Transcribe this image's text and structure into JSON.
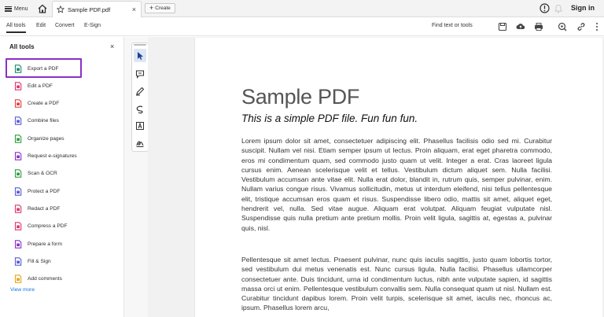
{
  "titlebar": {
    "menu_label": "Menu",
    "tab_label": "Sample PDF.pdf",
    "tab_close": "×",
    "create_label": "Create",
    "signin_label": "Sign in"
  },
  "menubar": {
    "tabs": [
      "All tools",
      "Edit",
      "Convert",
      "E-Sign"
    ],
    "find_label": "Find text or tools"
  },
  "left_panel": {
    "title": "All tools",
    "close": "×",
    "items": [
      {
        "label": "Export a PDF",
        "icon": "export-pdf-icon",
        "color": "#1a8a6c"
      },
      {
        "label": "Edit a PDF",
        "icon": "edit-pdf-icon",
        "color": "#e0356b"
      },
      {
        "label": "Create a PDF",
        "icon": "create-pdf-icon",
        "color": "#e0413a"
      },
      {
        "label": "Combine files",
        "icon": "combine-files-icon",
        "color": "#5a5ad8"
      },
      {
        "label": "Organize pages",
        "icon": "organize-pages-icon",
        "color": "#2f9d3f"
      },
      {
        "label": "Request e-signatures",
        "icon": "request-esignatures-icon",
        "color": "#8b2fc9"
      },
      {
        "label": "Scan & OCR",
        "icon": "scan-ocr-icon",
        "color": "#2f9d3f"
      },
      {
        "label": "Protect a PDF",
        "icon": "protect-pdf-icon",
        "color": "#5a5ad8"
      },
      {
        "label": "Redact a PDF",
        "icon": "redact-pdf-icon",
        "color": "#e0356b"
      },
      {
        "label": "Compress a PDF",
        "icon": "compress-pdf-icon",
        "color": "#e0356b"
      },
      {
        "label": "Prepare a form",
        "icon": "prepare-form-icon",
        "color": "#8b2fc9"
      },
      {
        "label": "Fill & Sign",
        "icon": "fill-sign-icon",
        "color": "#5a5ad8"
      },
      {
        "label": "Add comments",
        "icon": "add-comments-icon",
        "color": "#e8a317"
      }
    ],
    "view_more": "View more"
  },
  "document": {
    "title": "Sample PDF",
    "subtitle": "This is a simple PDF file. Fun fun fun.",
    "paragraph1": "Lorem ipsum dolor sit amet, consectetuer adipiscing elit. Phasellus facilisis odio sed mi. Curabitur suscipit. Nullam vel nisi. Etiam semper ipsum ut lectus. Proin aliquam, erat eget pharetra commodo, eros mi condimentum quam, sed commodo justo quam ut velit. Integer a erat. Cras laoreet ligula cursus enim. Aenean scelerisque velit et tellus. Vestibulum dictum aliquet sem. Nulla facilisi. Vestibulum accumsan ante vitae elit. Nulla erat dolor, blandit in, rutrum quis, semper pulvinar, enim. Nullam varius congue risus. Vivamus sollicitudin, metus ut interdum eleifend, nisi tellus pellentesque elit, tristique accumsan eros quam et risus. Suspendisse libero odio, mattis sit amet, aliquet eget, hendrerit vel, nulla. Sed vitae augue. Aliquam erat volutpat. Aliquam feugiat vulputate nisl. Suspendisse quis nulla pretium ante pretium mollis. Proin velit ligula, sagittis at, egestas a, pulvinar quis, nisl.",
    "paragraph2": "Pellentesque sit amet lectus. Praesent pulvinar, nunc quis iaculis sagittis, justo quam lobortis tortor, sed vestibulum dui metus venenatis est. Nunc cursus ligula. Nulla facilisi. Phasellus ullamcorper consectetuer ante. Duis tincidunt, urna id condimentum luctus, nibh ante vulputate sapien, id sagittis massa orci ut enim. Pellentesque vestibulum convallis sem. Nulla consequat quam ut nisl. Nullam est. Curabitur tincidunt dapibus lorem. Proin velit turpis, scelerisque sit amet, iaculis nec, rhoncus ac, ipsum. Phasellus lorem arcu,"
  },
  "colors": {
    "highlight": "#8b2fc9",
    "link": "#1473e6",
    "selected_tool_bg": "#dde6f4"
  }
}
